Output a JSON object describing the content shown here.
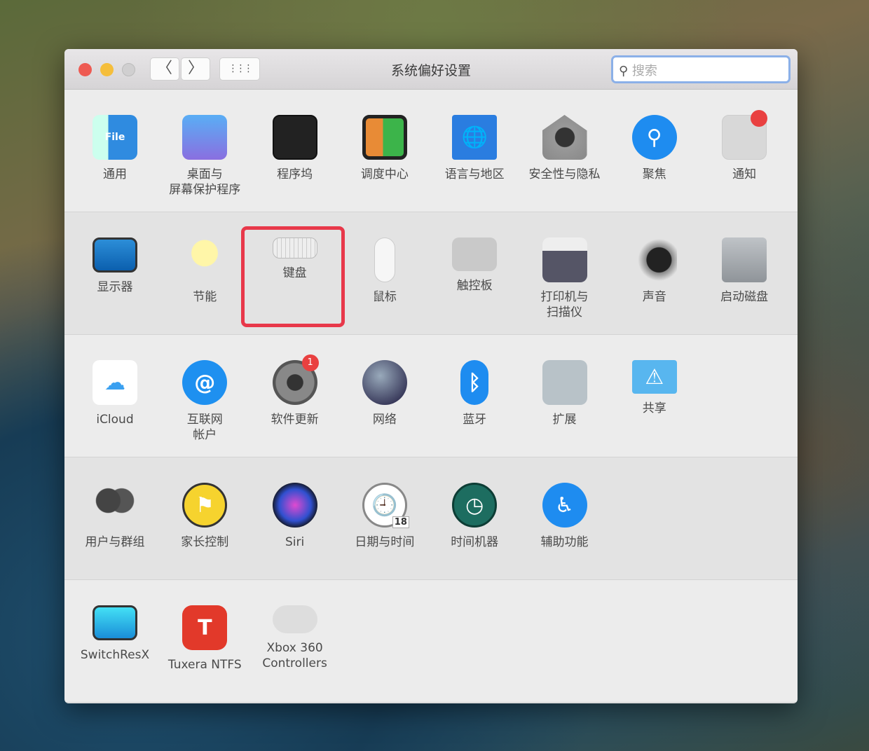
{
  "window": {
    "title": "系统偏好设置",
    "search_placeholder": "搜索",
    "back": "〈",
    "forward": "〉",
    "grid": "⋮⋮⋮"
  },
  "sections": [
    {
      "items": [
        {
          "label": "通用",
          "icon": "general"
        },
        {
          "label": "桌面与\n屏幕保护程序",
          "icon": "desktop"
        },
        {
          "label": "程序坞",
          "icon": "dock"
        },
        {
          "label": "调度中心",
          "icon": "mission"
        },
        {
          "label": "语言与地区",
          "icon": "language"
        },
        {
          "label": "安全性与隐私",
          "icon": "security"
        },
        {
          "label": "聚焦",
          "icon": "spotlight"
        },
        {
          "label": "通知",
          "icon": "notifications"
        }
      ]
    },
    {
      "items": [
        {
          "label": "显示器",
          "icon": "display"
        },
        {
          "label": "节能",
          "icon": "energy"
        },
        {
          "label": "键盘",
          "icon": "keyboard"
        },
        {
          "label": "鼠标",
          "icon": "mouse"
        },
        {
          "label": "触控板",
          "icon": "trackpad"
        },
        {
          "label": "打印机与\n扫描仪",
          "icon": "printer"
        },
        {
          "label": "声音",
          "icon": "sound"
        },
        {
          "label": "启动磁盘",
          "icon": "disk"
        }
      ]
    },
    {
      "items": [
        {
          "label": "iCloud",
          "icon": "icloud"
        },
        {
          "label": "互联网\n帐户",
          "icon": "internet"
        },
        {
          "label": "软件更新",
          "icon": "update",
          "badge": "1"
        },
        {
          "label": "网络",
          "icon": "network"
        },
        {
          "label": "蓝牙",
          "icon": "bluetooth"
        },
        {
          "label": "扩展",
          "icon": "extensions"
        },
        {
          "label": "共享",
          "icon": "sharing"
        }
      ]
    },
    {
      "items": [
        {
          "label": "用户与群组",
          "icon": "users"
        },
        {
          "label": "家长控制",
          "icon": "parental"
        },
        {
          "label": "Siri",
          "icon": "siri"
        },
        {
          "label": "日期与时间",
          "icon": "datetime",
          "badge_text": "18"
        },
        {
          "label": "时间机器",
          "icon": "timemachine"
        },
        {
          "label": "辅助功能",
          "icon": "accessibility"
        }
      ]
    },
    {
      "items": [
        {
          "label": "SwitchResX",
          "icon": "switchresx"
        },
        {
          "label": "Tuxera NTFS",
          "icon": "tuxera"
        },
        {
          "label": "Xbox 360\nControllers",
          "icon": "xbox"
        }
      ]
    }
  ],
  "highlight": {
    "item": "键盘"
  },
  "colors": {
    "close": "#ee5a52",
    "minimize": "#f5be3b",
    "highlight": "#e8384a"
  }
}
